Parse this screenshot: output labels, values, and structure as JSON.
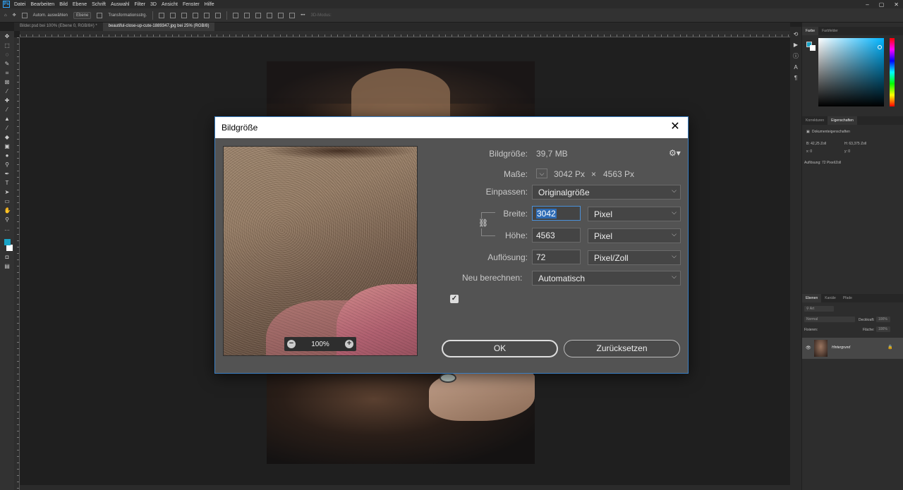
{
  "menubar": {
    "logo": "Ps",
    "items": [
      "Datei",
      "Bearbeiten",
      "Bild",
      "Ebene",
      "Schrift",
      "Auswahl",
      "Filter",
      "3D",
      "Ansicht",
      "Fenster",
      "Hilfe"
    ]
  },
  "optionsbar": {
    "auto_select": "Autom. auswählen",
    "layer_dropdown": "Ebene",
    "transform": "Transformationsstrg.",
    "mode_3d": "3D-Modus:"
  },
  "tabs": [
    {
      "label": "Bilder.psd bei 100% (Ebene 0, RGB/8#) *"
    },
    {
      "label": "beautiful-close-up-cute-1889347.jpg bei 25% (RGB/8)"
    }
  ],
  "rpanel": {
    "color_tabs": [
      "Farbe",
      "Farbfelder"
    ],
    "props_tabs": [
      "Korrekturen",
      "Eigenschaften"
    ],
    "props_title": "Dokumenteigenschaften",
    "props_b": "B: 42,25 Zoll",
    "props_h": "H: 63,375 Zoll",
    "props_x": "x: 0",
    "props_y": "y: 0",
    "props_res": "Auflösung: 72 Pixel/Zoll",
    "layers_tabs": [
      "Ebenen",
      "Kanäle",
      "Pfade"
    ],
    "layers_kind": "Art",
    "layers_blend": "Normal",
    "layers_opacity": "Deckkraft:",
    "layers_opacity_val": "100%",
    "layers_lock": "Fixieren:",
    "layers_fill": "Fläche:",
    "layers_fill_val": "100%",
    "layer_name": "Hintergrund"
  },
  "colors": {
    "foreground": "#19a3c6",
    "background": "#ffffff",
    "accent": "#3a7fc4"
  },
  "dialog": {
    "title": "Bildgröße",
    "bildgroesse_label": "Bildgröße:",
    "bildgroesse_value": "39,7 MB",
    "masse_label": "Maße:",
    "masse_w": "3042 Px",
    "masse_x": "×",
    "masse_h": "4563 Px",
    "einpassen_label": "Einpassen:",
    "einpassen_value": "Originalgröße",
    "breite_label": "Breite:",
    "breite_value": "3042",
    "breite_unit": "Pixel",
    "hoehe_label": "Höhe:",
    "hoehe_value": "4563",
    "hoehe_unit": "Pixel",
    "aufloesung_label": "Auflösung:",
    "aufloesung_value": "72",
    "aufloesung_unit": "Pixel/Zoll",
    "neu_berechnen_label": "Neu berechnen:",
    "neu_berechnen_checked": true,
    "neu_berechnen_value": "Automatisch",
    "zoom": "100%",
    "ok_label": "OK",
    "reset_label": "Zurücksetzen"
  }
}
